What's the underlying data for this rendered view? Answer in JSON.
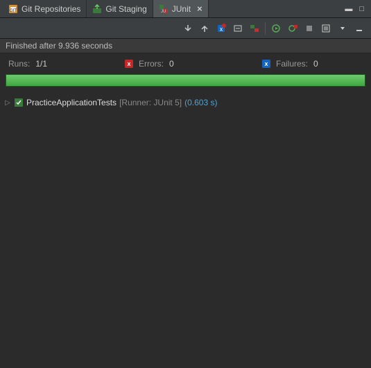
{
  "tabs": [
    {
      "label": "Git Repositories",
      "icon": "git-repo-icon"
    },
    {
      "label": "Git Staging",
      "icon": "git-staging-icon"
    },
    {
      "label": "JUnit",
      "icon": "junit-icon",
      "active": true,
      "closable": true
    }
  ],
  "status": "Finished after 9.936 seconds",
  "stats": {
    "runs_label": "Runs:",
    "runs_value": "1/1",
    "errors_label": "Errors:",
    "errors_value": "0",
    "failures_label": "Failures:",
    "failures_value": "0"
  },
  "progress_percent": 100,
  "tree": {
    "item": {
      "name": "PracticeApplicationTests",
      "runner": "[Runner: JUnit 5]",
      "time": "(0.603 s)"
    }
  },
  "colors": {
    "success_bar": "#3ea83e",
    "link": "#4fa3d1",
    "error_badge": "#c62828",
    "failure_badge": "#1565c0"
  }
}
